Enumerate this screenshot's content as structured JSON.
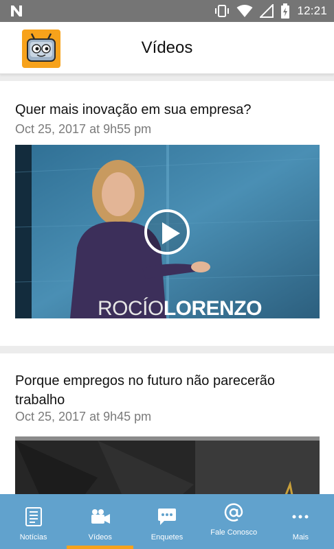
{
  "status_bar": {
    "time": "12:21",
    "icons": [
      "n-notification-icon",
      "vibrate-icon",
      "wifi-icon",
      "signal-icon",
      "battery-charging-icon"
    ]
  },
  "app_bar": {
    "title": "Vídeos",
    "logo_icon": "robot-tv-logo-icon"
  },
  "feed": {
    "items": [
      {
        "title": "Quer mais inovação em sua empresa?",
        "date": "Oct 25, 2017 at 9h55 pm",
        "thumbnail_caption_first": "ROCÍO",
        "thumbnail_caption_last": "LORENZO"
      },
      {
        "title": "Porque empregos no futuro não parecerão trabalho",
        "date": "Oct 25, 2017 at 9h45 pm"
      }
    ]
  },
  "bottom_nav": {
    "active": "Vídeos",
    "items": [
      {
        "label": "Notícias",
        "icon": "newspaper-icon"
      },
      {
        "label": "Vídeos",
        "icon": "video-camera-icon"
      },
      {
        "label": "Enquetes",
        "icon": "chat-bubble-icon"
      },
      {
        "label": "Fale Conosco",
        "icon": "at-sign-icon"
      },
      {
        "label": "Mais",
        "icon": "more-dots-icon"
      }
    ]
  },
  "colors": {
    "status_bar": "#757575",
    "nav_background": "#61a2cd",
    "nav_active_indicator": "#f7a21b",
    "logo_background": "#f7a21b",
    "date_text": "#7a7a7a"
  }
}
